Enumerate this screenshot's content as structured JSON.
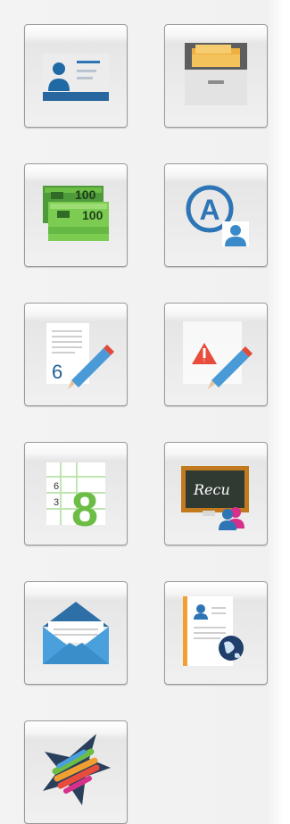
{
  "tiles": [
    {
      "id": "id-card",
      "icon": "id-card-icon"
    },
    {
      "id": "file-cabinet",
      "icon": "file-cabinet-icon"
    },
    {
      "id": "banknotes",
      "icon": "banknotes-icon",
      "texts": [
        "100",
        "100"
      ]
    },
    {
      "id": "user-account",
      "icon": "user-account-icon",
      "texts": [
        "A"
      ]
    },
    {
      "id": "grade-edit",
      "icon": "grade-edit-icon",
      "texts": [
        "6"
      ]
    },
    {
      "id": "warning-edit",
      "icon": "warning-edit-icon",
      "texts": [
        "!"
      ]
    },
    {
      "id": "grades-table",
      "icon": "grades-table-icon",
      "texts": [
        "6",
        "3",
        "8"
      ]
    },
    {
      "id": "blackboard",
      "icon": "blackboard-icon",
      "texts": [
        "Recu"
      ]
    },
    {
      "id": "mail",
      "icon": "envelope-icon"
    },
    {
      "id": "directory",
      "icon": "contact-book-icon"
    },
    {
      "id": "star",
      "icon": "star-icon"
    }
  ],
  "colors": {
    "blue": "#2e75b6",
    "light_blue": "#5aa9de",
    "green": "#6cbd45",
    "red": "#e74c3c",
    "orange": "#f0a030",
    "magenta": "#d62f8c"
  }
}
